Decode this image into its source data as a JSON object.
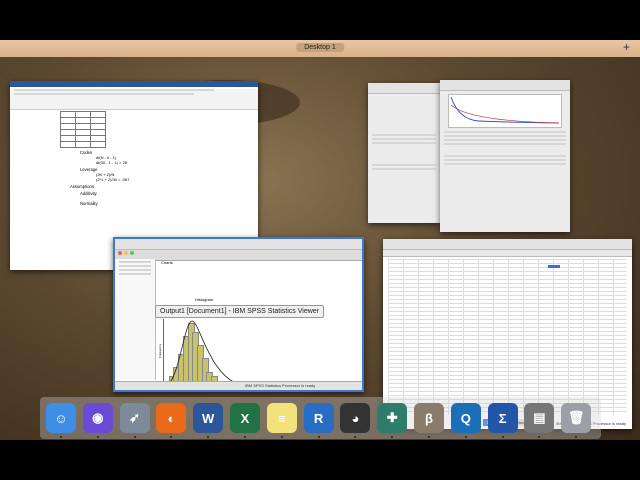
{
  "mission_control": {
    "desktop_label": "Desktop 1",
    "add_label": "+"
  },
  "windows": {
    "word": {
      "lines": {
        "codes": "Codes",
        "codes_df": "df(N - k - 1)",
        "codes_val": "df(30 - 1 - 1) = 28",
        "leverage": "Leverage",
        "leverage_eq": "(2K + 2)/N",
        "leverage_val": "(2*1 + 2)/30 = .067",
        "assumptions": "Assumptions",
        "additivity": "Additivity",
        "normality": "Normality"
      }
    },
    "spss_output": {
      "tooltip": "Output1 [Document1] - IBM SPSS Statistics Viewer",
      "heading": "Charts",
      "chart_title": "Histogram",
      "ylabel": "Frequency",
      "status": "IBM SPSS Statistics Processor is ready"
    },
    "data_editor": {
      "tab_data": "Data View",
      "tab_variable": "Variable View",
      "status": "IBM SPSS Statistics Processor is ready"
    }
  },
  "chart_data": {
    "type": "bar",
    "title": "Histogram",
    "ylabel": "Frequency",
    "values": [
      1,
      2,
      4,
      7,
      11,
      14,
      12,
      9,
      6,
      3,
      2,
      1,
      0,
      0,
      1,
      0,
      1
    ],
    "colors": {
      "bar": "#c8c26a"
    }
  },
  "dock": {
    "apps": [
      {
        "name": "finder-icon",
        "color": "#3d8ee6",
        "glyph": "☺"
      },
      {
        "name": "siri-icon",
        "color": "#6a4bd6",
        "glyph": "◉"
      },
      {
        "name": "launchpad-icon",
        "color": "#7d8a99",
        "glyph": "➶"
      },
      {
        "name": "firefox-icon",
        "color": "#e86a1a",
        "glyph": "◐"
      },
      {
        "name": "word-icon",
        "color": "#2b579a",
        "glyph": "W"
      },
      {
        "name": "excel-icon",
        "color": "#217346",
        "glyph": "X"
      },
      {
        "name": "notes-icon",
        "color": "#f3e27a",
        "glyph": "≡"
      },
      {
        "name": "r-icon",
        "color": "#276dc3",
        "glyph": "R"
      },
      {
        "name": "github-icon",
        "color": "#333333",
        "glyph": "◕"
      },
      {
        "name": "cfa-icon",
        "color": "#2e7d6b",
        "glyph": "✚"
      },
      {
        "name": "jasp-icon",
        "color": "#8a7c6b",
        "glyph": "β"
      },
      {
        "name": "quicktime-icon",
        "color": "#1b6fb8",
        "glyph": "Q"
      },
      {
        "name": "stats-icon",
        "color": "#2356a8",
        "glyph": "Σ"
      },
      {
        "name": "documents-icon",
        "color": "#777777",
        "glyph": "▤"
      },
      {
        "name": "trash-icon",
        "color": "#9aa0a6",
        "glyph": "🗑"
      }
    ]
  }
}
